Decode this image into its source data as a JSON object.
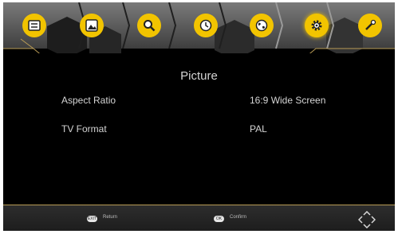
{
  "menu": {
    "items": [
      {
        "id": "channel",
        "icon": "channel-list-icon"
      },
      {
        "id": "picture",
        "icon": "picture-icon"
      },
      {
        "id": "search",
        "icon": "search-icon"
      },
      {
        "id": "time",
        "icon": "clock-icon"
      },
      {
        "id": "language",
        "icon": "globe-icon"
      },
      {
        "id": "setting",
        "icon": "gear-icon"
      },
      {
        "id": "tools",
        "icon": "tools-icon"
      }
    ],
    "active": "setting",
    "accent_color": "#f2c400"
  },
  "page": {
    "title": "Picture",
    "rows": [
      {
        "label": "Aspect Ratio",
        "value": "16:9 Wide Screen"
      },
      {
        "label": "TV Format",
        "value": "PAL"
      }
    ]
  },
  "footer": {
    "return_key": "EXIT",
    "return_label": "Return",
    "confirm_key": "OK",
    "confirm_label": "Confirm",
    "nav_icon": "navigation-arrows-icon"
  }
}
